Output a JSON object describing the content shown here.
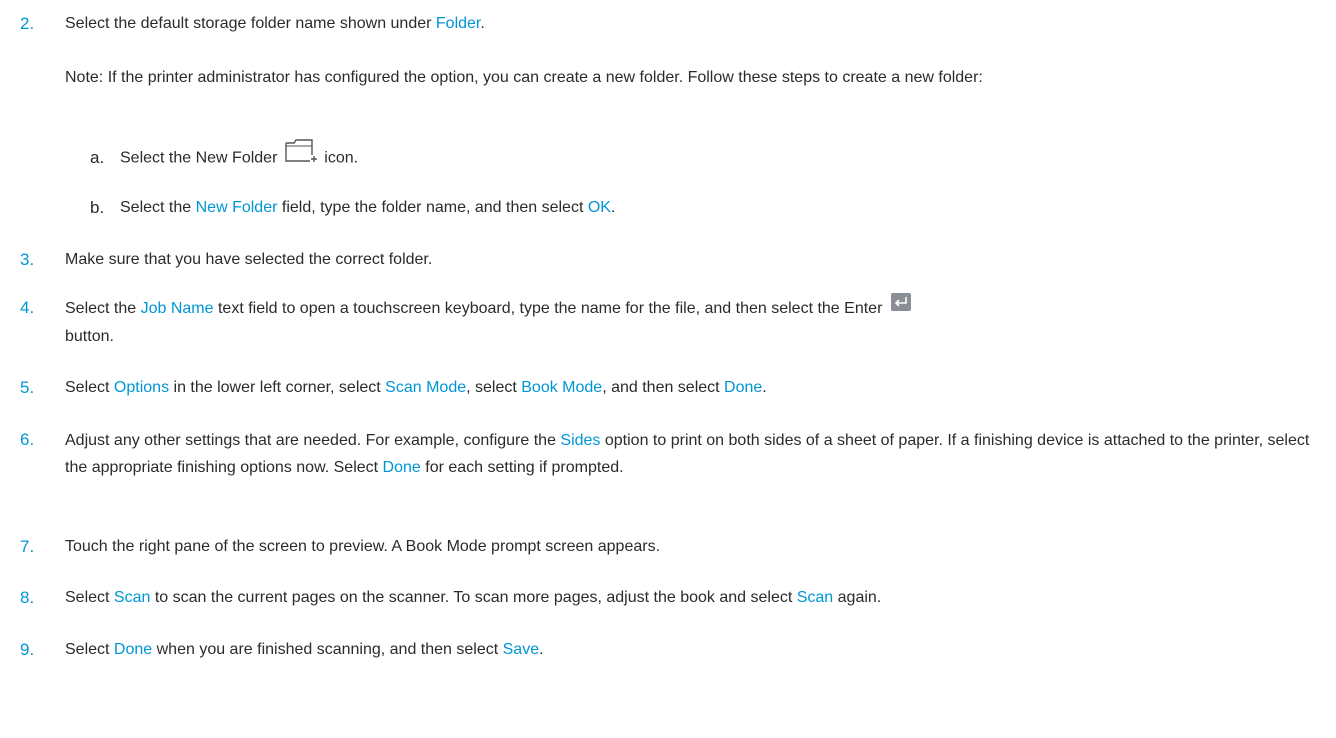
{
  "steps": {
    "s2": {
      "num": "2.",
      "p1": "Select the default storage folder name shown under ",
      "l1": "Folder",
      "p2": "."
    },
    "note": {
      "text": "Note: If the printer administrator has configured the option, you can create a new folder. Follow these steps to create a new folder:"
    },
    "sa": {
      "letter": "a.",
      "p1": "Select the New Folder ",
      "icon": "new-folder-icon",
      "p2": " icon."
    },
    "sb": {
      "letter": "b.",
      "p1": "Select the ",
      "l1": "New Folder",
      "p2": " field, type the folder name, and then select ",
      "l2": "OK",
      "p3": "."
    },
    "s3": {
      "num": "3.",
      "p1": "Make sure that you have selected the correct folder."
    },
    "s4": {
      "num": "4.",
      "p1": "Select the ",
      "l1": "Job Name",
      "p2": " text field to open a touchscreen keyboard, type the name for the file, and then select the Enter ",
      "icon": "enter-icon",
      "p3": "button."
    },
    "s5": {
      "num": "5.",
      "p1": "Select ",
      "l1": "Options",
      "p2": " in the lower left corner, select ",
      "l2": "Scan Mode",
      "p3": ", select ",
      "l3": "Book Mode",
      "p4": ", and then select ",
      "l4": "Done",
      "p5": "."
    },
    "s6": {
      "num": "6.",
      "p1": "Adjust any other settings that are needed. For example, configure the ",
      "l1": "Sides",
      "p2": " option to print on both sides of a sheet of paper. If a finishing device is attached to the printer, select the appropriate finishing options now. Select ",
      "l2": "Done",
      "p3": " for each setting if prompted."
    },
    "s7": {
      "num": "7.",
      "p1": "Touch the right pane of the screen to preview. A Book Mode prompt screen appears."
    },
    "s8": {
      "num": "8.",
      "p1": "Select ",
      "l1": "Scan",
      "p2": " to scan the current pages on the scanner. To scan more pages, adjust the book and select ",
      "l2": "Scan",
      "p3": " again."
    },
    "s9": {
      "num": "9.",
      "p1": "Select ",
      "l1": "Done",
      "p2": " when you are finished scanning, and then select ",
      "l2": "Save",
      "p3": "."
    }
  },
  "colors": {
    "link": "#0096d6",
    "text": "#2b2b2b"
  }
}
